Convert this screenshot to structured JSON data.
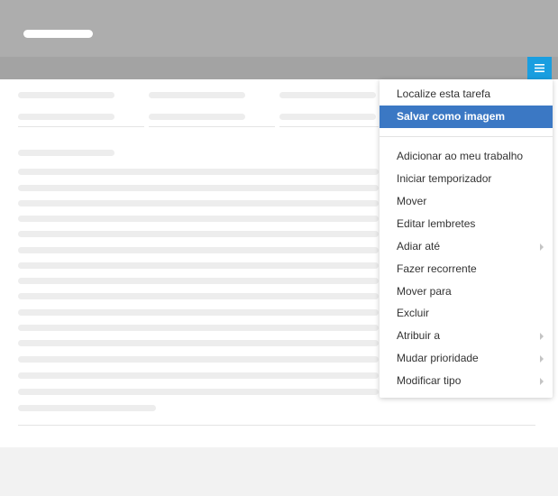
{
  "colors": {
    "header_bg": "#adadad",
    "subbar_bg": "#a3a3a3",
    "menu_button_bg": "#1a9ee0",
    "active_item_bg": "#3b78c4",
    "text": "#333333",
    "skeleton": "#ededed"
  },
  "header": {
    "menu_icon": "hamburger-icon"
  },
  "context_menu": {
    "groups": [
      {
        "items": [
          {
            "label": "Localize esta tarefa",
            "has_submenu": false,
            "active": false
          },
          {
            "label": "Salvar como imagem",
            "has_submenu": false,
            "active": true
          }
        ]
      },
      {
        "items": [
          {
            "label": "Adicionar ao meu trabalho",
            "has_submenu": false,
            "active": false
          },
          {
            "label": "Iniciar temporizador",
            "has_submenu": false,
            "active": false
          },
          {
            "label": "Mover",
            "has_submenu": false,
            "active": false
          },
          {
            "label": "Editar lembretes",
            "has_submenu": false,
            "active": false
          },
          {
            "label": "Adiar até",
            "has_submenu": true,
            "active": false
          },
          {
            "label": "Fazer recorrente",
            "has_submenu": false,
            "active": false
          },
          {
            "label": "Mover para",
            "has_submenu": false,
            "active": false
          },
          {
            "label": "Excluir",
            "has_submenu": false,
            "active": false
          },
          {
            "label": "Atribuir a",
            "has_submenu": true,
            "active": false
          },
          {
            "label": "Mudar prioridade",
            "has_submenu": true,
            "active": false
          },
          {
            "label": "Modificar tipo",
            "has_submenu": true,
            "active": false
          }
        ]
      }
    ]
  }
}
